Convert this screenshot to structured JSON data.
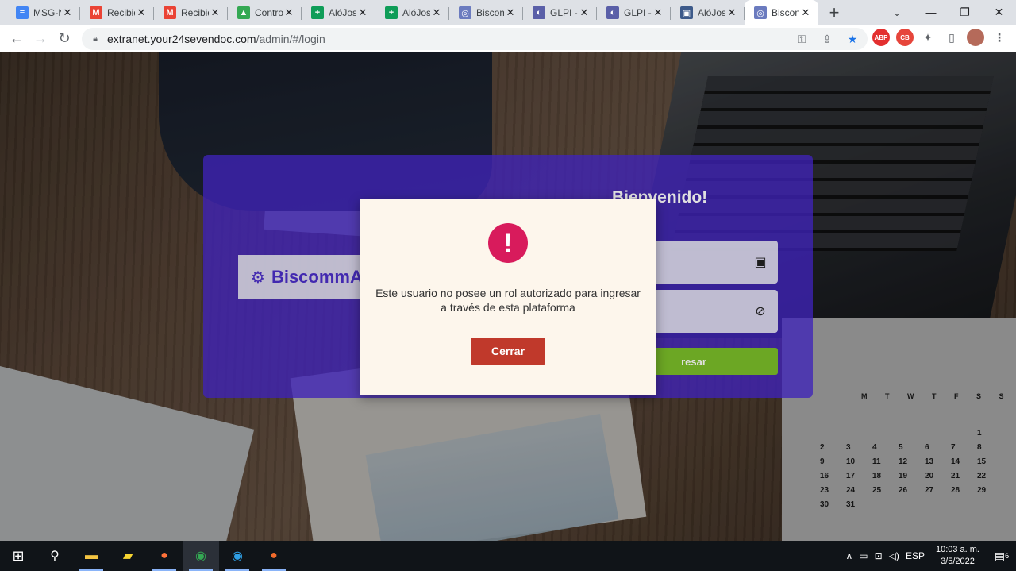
{
  "tabs": [
    {
      "title": "MSG-N",
      "fav": "≡",
      "fav_color": "#4285f4"
    },
    {
      "title": "Recibid",
      "fav": "M",
      "fav_color": "#ea4335"
    },
    {
      "title": "Recibid",
      "fav": "M",
      "fav_color": "#ea4335"
    },
    {
      "title": "Contro",
      "fav": "▲",
      "fav_color": "#34a853"
    },
    {
      "title": "AlóJos",
      "fav": "+",
      "fav_color": "#0f9d58"
    },
    {
      "title": "AlóJos",
      "fav": "+",
      "fav_color": "#0f9d58"
    },
    {
      "title": "Biscom",
      "fav": "◎",
      "fav_color": "#6b7bbf"
    },
    {
      "title": "GLPI -",
      "fav": "◐",
      "fav_color": "#5a5fa8"
    },
    {
      "title": "GLPI -",
      "fav": "◐",
      "fav_color": "#5a5fa8"
    },
    {
      "title": "AlóJos",
      "fav": "▣",
      "fav_color": "#3d5a8a"
    },
    {
      "title": "Biscon",
      "fav": "◎",
      "fav_color": "#6b7bbf",
      "active": true
    }
  ],
  "address_bar": {
    "host": "extranet.your24sevendoc.com",
    "path": "/admin/#/login"
  },
  "extensions": [
    {
      "name": "abp-icon",
      "label": "ABP",
      "color": "#e32f2f"
    },
    {
      "name": "cb-icon",
      "label": "CB",
      "color": "#e6453b"
    }
  ],
  "login": {
    "brand": "BiscommA",
    "welcome": "Bienvenido!",
    "submit_label": "resar"
  },
  "modal": {
    "message": "Este usuario no posee un rol autorizado para ingresar a través de esta plataforma",
    "close_label": "Cerrar",
    "icon": "!"
  },
  "calendar": {
    "header": "M T W T F S S",
    "days": [
      "",
      "",
      "",
      "",
      "",
      "",
      "1",
      "2",
      "3",
      "4",
      "5",
      "6",
      "7",
      "8",
      "9",
      "10",
      "11",
      "12",
      "13",
      "14",
      "15",
      "16",
      "17",
      "18",
      "19",
      "20",
      "21",
      "22",
      "23",
      "24",
      "25",
      "26",
      "27",
      "28",
      "29",
      "30",
      "31"
    ]
  },
  "taskbar": {
    "language": "ESP",
    "time": "10:03 a. m.",
    "date": "3/5/2022",
    "notifications": "6"
  }
}
